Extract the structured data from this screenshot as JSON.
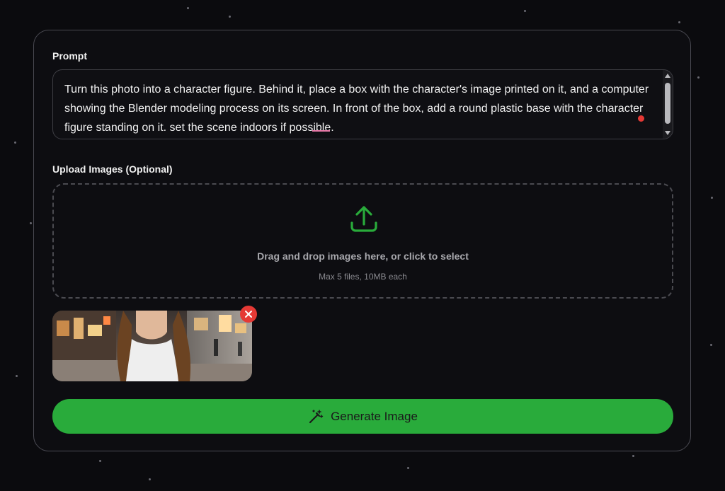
{
  "prompt": {
    "label": "Prompt",
    "value": "Turn this photo into a character figure. Behind it, place a box with the character's image printed on it, and a computer showing the Blender modeling process on its screen. In front of the box, add a round plastic base with the character figure standing on it. set the scene indoors if possible."
  },
  "upload": {
    "label": "Upload Images (Optional)",
    "icon": "upload-icon",
    "title": "Drag and drop images here, or click to select",
    "subtitle": "Max 5 files, 10MB each"
  },
  "uploaded_image": {
    "icon": "image-thumbnail",
    "remove_icon": "close-icon"
  },
  "generate": {
    "label": "Generate Image",
    "icon": "magic-wand-icon"
  },
  "colors": {
    "accent": "#29ab3b",
    "danger": "#e53935",
    "background": "#0b0b0e"
  }
}
